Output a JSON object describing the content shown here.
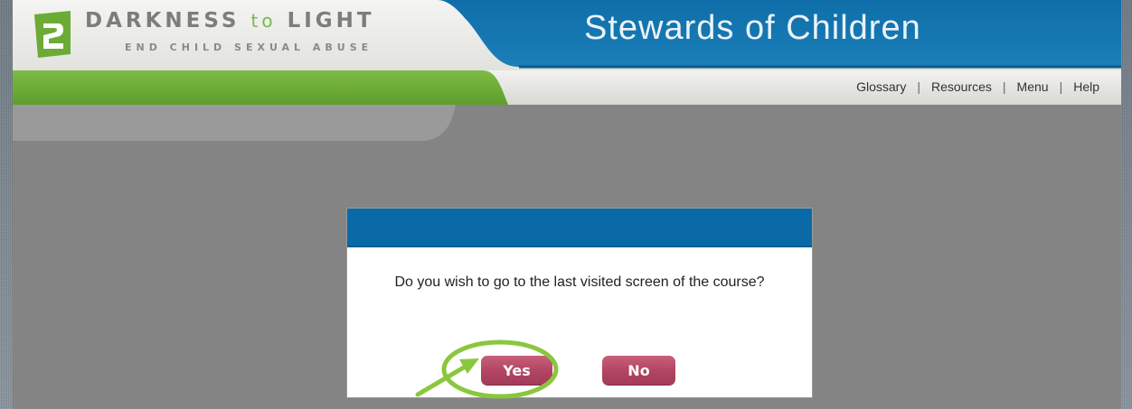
{
  "header": {
    "brand_title_main": "DARKNESS",
    "brand_title_to": "to",
    "brand_title_end": "LIGHT",
    "brand_subtitle": "END CHILD SEXUAL ABUSE",
    "course_title": "Stewards of Children",
    "logo_icon": "dtl-logo-icon",
    "colors": {
      "blue": "#0a6aa8",
      "green": "#6cab35",
      "brand_gray": "#7d7d7d"
    }
  },
  "nav": {
    "links": [
      "Glossary",
      "Resources",
      "Menu",
      "Help"
    ],
    "separator": "|"
  },
  "dialog": {
    "message": "Do you wish to go to the last visited screen of the course?",
    "yes_label": "Yes",
    "no_label": "No",
    "button_color": "#b34664"
  },
  "annotation": {
    "color": "#8bc63f",
    "target": "yes-button"
  }
}
